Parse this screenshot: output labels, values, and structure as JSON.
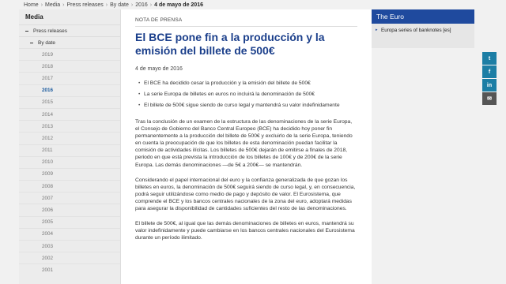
{
  "breadcrumb": [
    "Home",
    "Media",
    "Press releases",
    "By date",
    "2016",
    "4 de mayo de 2016"
  ],
  "sidebar": {
    "title": "Media",
    "section": "Press releases",
    "subsection": "By date",
    "years": [
      "2019",
      "2018",
      "2017",
      "2016",
      "2015",
      "2014",
      "2013",
      "2012",
      "2011",
      "2010",
      "2009",
      "2008",
      "2007",
      "2006",
      "2005",
      "2004",
      "2003",
      "2002",
      "2001"
    ],
    "active_year": "2016"
  },
  "article": {
    "kicker": "NOTA DE PRENSA",
    "title": "El BCE pone fin a la producción y la emisión del billete de 500€",
    "date": "4 de mayo de 2016",
    "bullets": [
      "El BCE ha decidido cesar la producción y la emisión del billete de 500€",
      "La serie Europa de billetes en euros no incluirá la denominación de 500€",
      "El billete de 500€ sigue siendo de curso legal y mantendrá su valor indefinidamente"
    ],
    "paragraphs": [
      "Tras la conclusión de un examen de la estructura de las denominaciones de la serie Europa, el Consejo de Gobierno del Banco Central Europeo (BCE) ha decidido hoy poner fin permanentemente a la producción del billete de 500€ y excluirlo de la serie Europa, teniendo en cuenta la preocupación de que los billetes de esta denominación puedan facilitar la comisión de actividades ilícitas. Los billetes de 500€ dejarán de emitirse a finales de 2018, periodo en que está prevista la introducción de los billetes de 100€ y de 200€ de la serie Europa. Las demás denominaciones —de 5€ a 200€— se mantendrán.",
      "Considerando el papel internacional del euro y la confianza generalizada de que gozan los billetes en euros, la denominación de 500€ seguirá siendo de curso legal, y, en consecuencia, podrá seguir utilizándose como medio de pago y depósito de valor. El Eurosistema, que comprende el BCE y los bancos centrales nacionales de la zona del euro, adoptará medidas para asegurar la disponibilidad de cantidades suficientes del resto de las denominaciones.",
      "El billete de 500€, al igual que las demás denominaciones de billetes en euros, mantendrá su valor indefinidamente y puede cambiarse en los bancos centrales nacionales del Eurosistema durante un período ilimitado."
    ]
  },
  "aside": {
    "title": "The Euro",
    "link": "Europa series of banknotes [es]"
  },
  "social": {
    "twitter": "t",
    "facebook": "f",
    "linkedin": "in",
    "email": "✉"
  }
}
